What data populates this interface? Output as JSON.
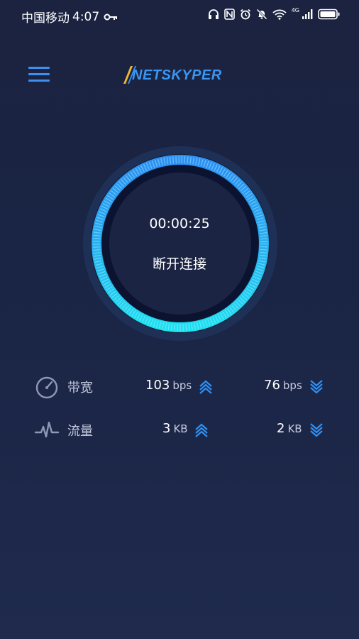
{
  "status_bar": {
    "carrier": "中国移动",
    "time": "4:07",
    "network": "4G",
    "icons": [
      "key-icon",
      "headphones-icon",
      "nfc-icon",
      "alarm-icon",
      "mute-icon",
      "wifi-icon",
      "signal-icon",
      "battery-icon"
    ]
  },
  "header": {
    "menu_icon": "menu-icon",
    "logo_text": "NETSKYPER"
  },
  "connection": {
    "elapsed_time": "00:00:25",
    "action_label": "断开连接"
  },
  "stats": [
    {
      "icon": "speedometer-icon",
      "label": "带宽",
      "upload_value": "103",
      "upload_unit": "bps",
      "download_value": "76",
      "download_unit": "bps"
    },
    {
      "icon": "pulse-icon",
      "label": "流量",
      "upload_value": "3",
      "upload_unit": "KB",
      "download_value": "2",
      "download_unit": "KB"
    }
  ],
  "colors": {
    "accent": "#3d8ff0",
    "ring": "#22c4ee",
    "background": "#1b2340"
  }
}
